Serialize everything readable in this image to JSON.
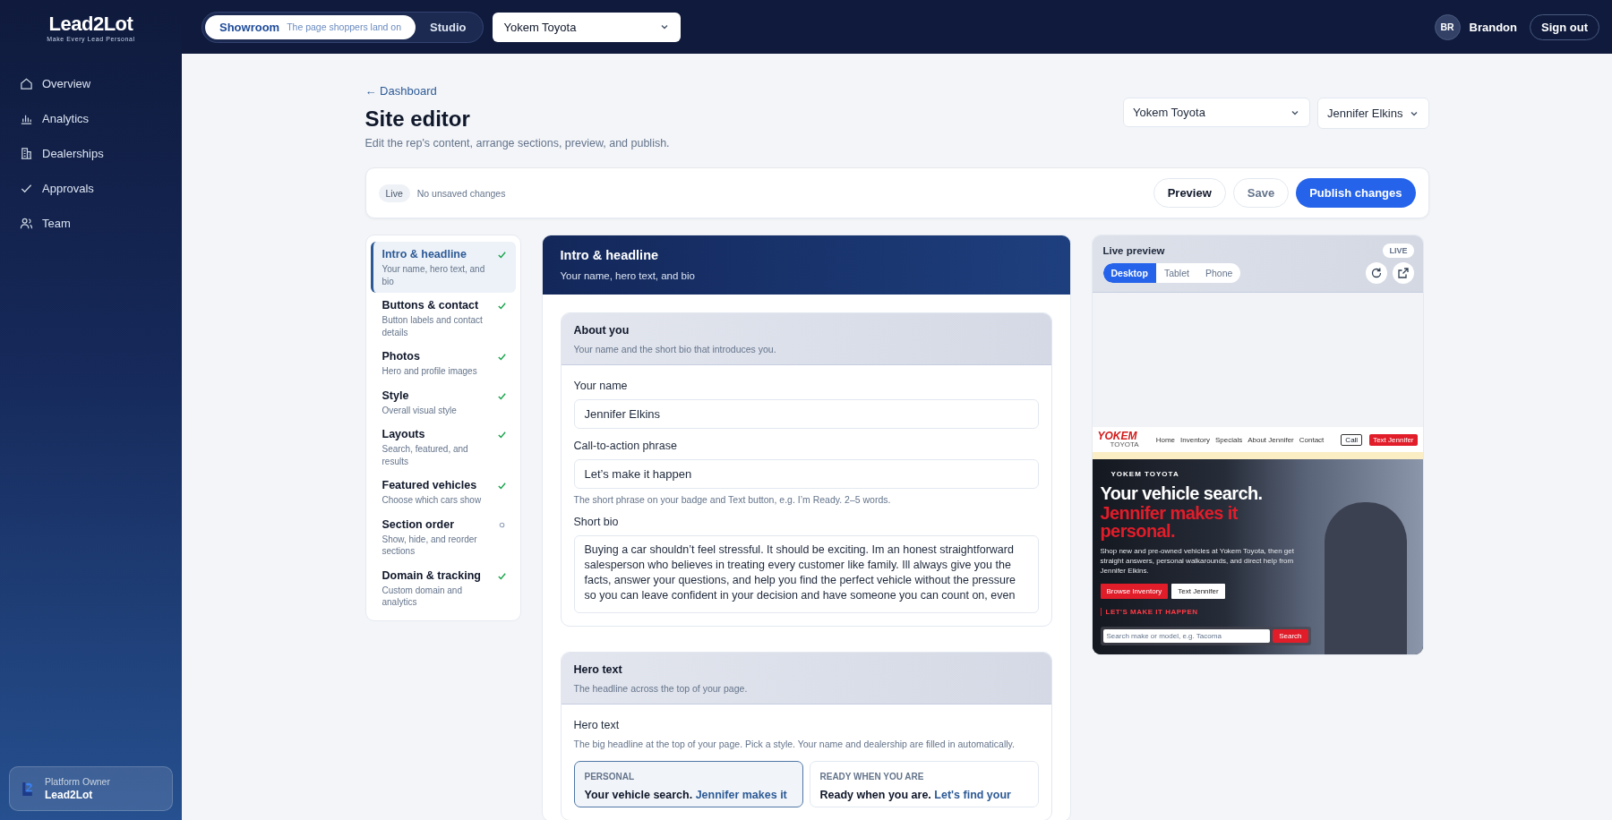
{
  "brand": {
    "name": "Lead2Lot",
    "tagline": "Make Every Lead Personal"
  },
  "sidebar": {
    "items": [
      {
        "label": "Overview"
      },
      {
        "label": "Analytics"
      },
      {
        "label": "Dealerships"
      },
      {
        "label": "Approvals"
      },
      {
        "label": "Team"
      }
    ],
    "account": {
      "role": "Platform Owner",
      "name": "Lead2Lot"
    }
  },
  "topbar": {
    "modes": [
      {
        "label": "Showroom",
        "hint": "The page shoppers land on",
        "selected": true
      },
      {
        "label": "Studio",
        "selected": false
      }
    ],
    "dealer_select": "Yokem Toyota",
    "user": {
      "initials": "BR",
      "name": "Brandon"
    },
    "sign_out": "Sign out"
  },
  "page": {
    "back_link": "← Dashboard",
    "title": "Site editor",
    "subtitle": "Edit the rep's content, arrange sections, preview, and publish.",
    "dealer_select": "Yokem Toyota",
    "rep_select": "Jennifer Elkins"
  },
  "toolbar": {
    "status_badge": "Live",
    "status_text": "No unsaved changes",
    "buttons": [
      {
        "label": "Preview",
        "kind": "outline"
      },
      {
        "label": "Save",
        "kind": "muted"
      },
      {
        "label": "Publish changes",
        "kind": "primary"
      }
    ]
  },
  "sections": [
    {
      "title": "Intro & headline",
      "subtitle": "Your name, hero text, and bio",
      "done": true,
      "selected": true
    },
    {
      "title": "Buttons & contact",
      "subtitle": "Button labels and contact details",
      "done": true,
      "selected": false
    },
    {
      "title": "Photos",
      "subtitle": "Hero and profile images",
      "done": true,
      "selected": false
    },
    {
      "title": "Style",
      "subtitle": "Overall visual style",
      "done": true,
      "selected": false
    },
    {
      "title": "Layouts",
      "subtitle": "Search, featured, and results",
      "done": true,
      "selected": false
    },
    {
      "title": "Featured vehicles",
      "subtitle": "Choose which cars show",
      "done": true,
      "selected": false
    },
    {
      "title": "Section order",
      "subtitle": "Show, hide, and reorder sections",
      "done": false,
      "selected": false
    },
    {
      "title": "Domain & tracking",
      "subtitle": "Custom domain and analytics",
      "done": true,
      "selected": false
    }
  ],
  "editor": {
    "title": "Intro & headline",
    "subtitle": "Your name, hero text, and bio",
    "about": {
      "title": "About you",
      "subtitle": "Your name and the short bio that introduces you.",
      "name_label": "Your name",
      "name_value": "Jennifer Elkins",
      "cta_label": "Call-to-action phrase",
      "cta_value": "Let’s make it happen",
      "cta_help": "The short phrase on your badge and Text button, e.g. I’m Ready. 2–5 words.",
      "bio_label": "Short bio",
      "bio_value": "Buying a car shouldn’t feel stressful. It should be exciting. Im an honest straightforward salesperson who believes in treating every customer like family. Ill always give you the facts, answer your questions, and help you find the perfect vehicle without the pressure so you can leave confident in your decision and have someone you can count on, even"
    },
    "hero": {
      "title": "Hero text",
      "subtitle": "The headline across the top of your page.",
      "label": "Hero text",
      "help": "The big headline at the top of your page. Pick a style. Your name and dealership are filled in automatically.",
      "options": [
        {
          "tag": "PERSONAL",
          "lead": "Your vehicle search.",
          "accent": "Jennifer makes it",
          "selected": true
        },
        {
          "tag": "READY WHEN YOU ARE",
          "lead": "Ready when you are.",
          "accent": "Let's find your",
          "selected": false
        }
      ]
    }
  },
  "preview": {
    "title": "Live preview",
    "badge": "LIVE",
    "devices": [
      {
        "label": "Desktop",
        "selected": true
      },
      {
        "label": "Tablet",
        "selected": false
      },
      {
        "label": "Phone",
        "selected": false
      }
    ],
    "site": {
      "logo": "YOKEM",
      "logo_sub": "TOYOTA",
      "nav": [
        "Home",
        "Inventory",
        "Specials",
        "About Jennifer",
        "Contact"
      ],
      "call": "Call",
      "text_button": "Text Jennifer",
      "eyebrow": "YOKEM TOYOTA",
      "headline": "Your vehicle search.",
      "headline_accent": "Jennifer makes it personal.",
      "intro": "Shop new and pre-owned vehicles at Yokem Toyota, then get straight answers, personal walkarounds, and direct help from Jennifer Elkins.",
      "browse": "Browse Inventory",
      "text_cta": "Text Jennifer",
      "cta_phrase": "LET'S MAKE IT HAPPEN",
      "search_placeholder": "Search make or model, e.g. Tacoma",
      "search_button": "Search"
    }
  }
}
